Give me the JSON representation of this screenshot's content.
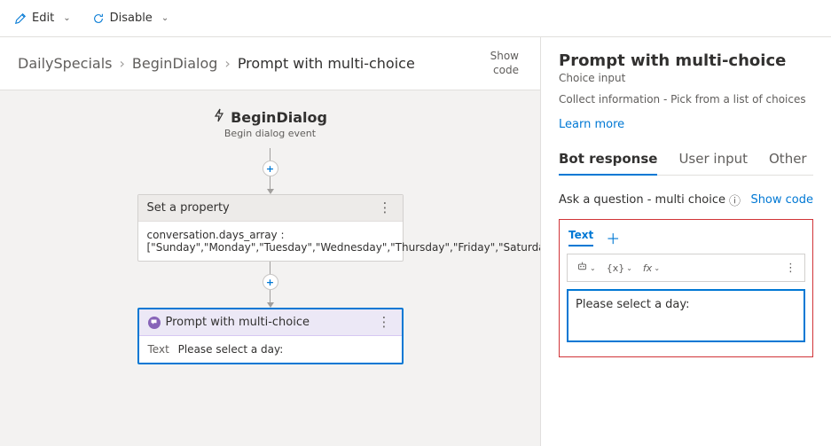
{
  "toolbar": {
    "edit": "Edit",
    "disable": "Disable"
  },
  "breadcrumb": {
    "root": "DailySpecials",
    "dialog": "BeginDialog",
    "step": "Prompt with multi-choice"
  },
  "showCode": "Show\ncode",
  "trigger": {
    "title": "BeginDialog",
    "subtitle": "Begin dialog event"
  },
  "cards": {
    "setProperty": {
      "title": "Set a property",
      "body": "conversation.days_array : [\"Sunday\",\"Monday\",\"Tuesday\",\"Wednesday\",\"Thursday\",\"Friday\",\"Saturday\"]"
    },
    "prompt": {
      "title": "Prompt with multi-choice",
      "label": "Text",
      "value": "Please select a day:"
    }
  },
  "panel": {
    "title": "Prompt with multi-choice",
    "subtitle": "Choice input",
    "desc": "Collect information - Pick from a list of choices",
    "learn": "Learn more",
    "tabs": {
      "botResponse": "Bot response",
      "userInput": "User input",
      "other": "Other"
    },
    "askLabel": "Ask a question - multi choice",
    "showCode": "Show code",
    "subtab": "Text",
    "variableBtn": "{x}",
    "fxBtn": "fx",
    "inputValue": "Please select a day:"
  }
}
